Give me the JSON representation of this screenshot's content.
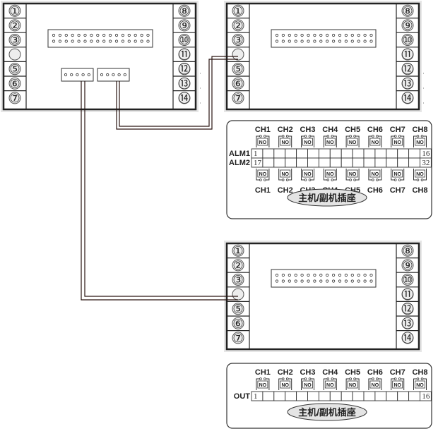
{
  "diagram": {
    "type": "wiring-diagram",
    "colors": {
      "wire": "#2a1512",
      "frame": "#222222",
      "panel_shadow": "#e6e6e6",
      "terminal_fill": "#ededed",
      "badge_fill": "#e4e4e4"
    },
    "controllers": [
      {
        "id": "host",
        "role": "host controller",
        "left_terminals": [
          "①",
          "②",
          "③",
          "",
          "⑤",
          "⑥",
          "⑦"
        ],
        "right_terminals": [
          "⑧",
          "⑨",
          "⑩",
          "⑪",
          "⑫",
          "⑬",
          "⑭"
        ],
        "connectors": [
          "dual-row-header",
          "5-pin-port-a",
          "5-pin-port-b"
        ]
      },
      {
        "id": "alarm-slave",
        "role": "alarm slave controller",
        "left_terminals": [
          "①",
          "②",
          "③",
          "",
          "⑤",
          "⑥",
          "⑦"
        ],
        "right_terminals": [
          "⑧",
          "⑨",
          "⑩",
          "⑪",
          "⑫",
          "⑬",
          "⑭"
        ],
        "connectors": [
          "dual-row-header"
        ]
      },
      {
        "id": "output-slave",
        "role": "output slave controller",
        "left_terminals": [
          "①",
          "②",
          "③",
          "",
          "⑤",
          "⑥",
          "⑦"
        ],
        "right_terminals": [
          "⑧",
          "⑨",
          "⑩",
          "⑪",
          "⑫",
          "⑬",
          "⑭"
        ],
        "connectors": [
          "dual-row-header"
        ]
      }
    ],
    "wires": [
      {
        "from": "host.5-pin-port-b",
        "to": "alarm-slave.terminal-4",
        "conductors": 2
      },
      {
        "from": "host.5-pin-port-a",
        "to": "output-slave.terminal-4",
        "conductors": 2
      }
    ],
    "alarm_socket": {
      "channels": [
        "CH1",
        "CH2",
        "CH3",
        "CH4",
        "CH5",
        "CH6",
        "CH7",
        "CH8"
      ],
      "contact_label": "NO",
      "rows": [
        {
          "label": "ALM1",
          "first": "1",
          "last": "16"
        },
        {
          "label": "ALM2",
          "first": "17",
          "last": "32"
        }
      ],
      "badge": "主机/副机插座"
    },
    "output_socket": {
      "channels": [
        "CH1",
        "CH2",
        "CH3",
        "CH4",
        "CH5",
        "CH6",
        "CH7",
        "CH8"
      ],
      "contact_label": "NO",
      "rows": [
        {
          "label": "OUT",
          "first": "1",
          "last": "16"
        }
      ],
      "badge": "主机/副机插座"
    }
  }
}
